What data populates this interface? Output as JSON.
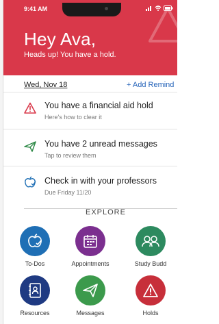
{
  "status": {
    "time": "9:41 AM"
  },
  "header": {
    "greeting": "Hey Ava,",
    "subtitle": "Heads up! You have a hold."
  },
  "date_row": {
    "date": "Wed, Nov 18",
    "add_reminder": "+ Add Remind"
  },
  "cards": [
    {
      "title": "You have a financial aid hold",
      "subtitle": "Here's how to clear it",
      "icon": "warning-icon"
    },
    {
      "title": "You have 2 unread messages",
      "subtitle": "Tap to review them",
      "icon": "paper-plane-icon"
    },
    {
      "title": "Check in with your professors",
      "subtitle": "Due Friday 11/20",
      "icon": "apple-check-icon"
    }
  ],
  "explore": {
    "title": "EXPLORE",
    "tiles": [
      {
        "label": "To-Dos",
        "color": "#1f6fb5",
        "icon": "apple-check-icon"
      },
      {
        "label": "Appointments",
        "color": "#7b2f8f",
        "icon": "calendar-icon"
      },
      {
        "label": "Study Budd",
        "color": "#2d8a5f",
        "icon": "people-icon"
      },
      {
        "label": "Resources",
        "color": "#1f3a82",
        "icon": "contacts-book-icon"
      },
      {
        "label": "Messages",
        "color": "#3c9a4c",
        "icon": "paper-plane-icon"
      },
      {
        "label": "Holds",
        "color": "#c72f3a",
        "icon": "warning-icon"
      }
    ]
  },
  "colors": {
    "header_bg": "#d9384a",
    "link": "#2563b9"
  }
}
